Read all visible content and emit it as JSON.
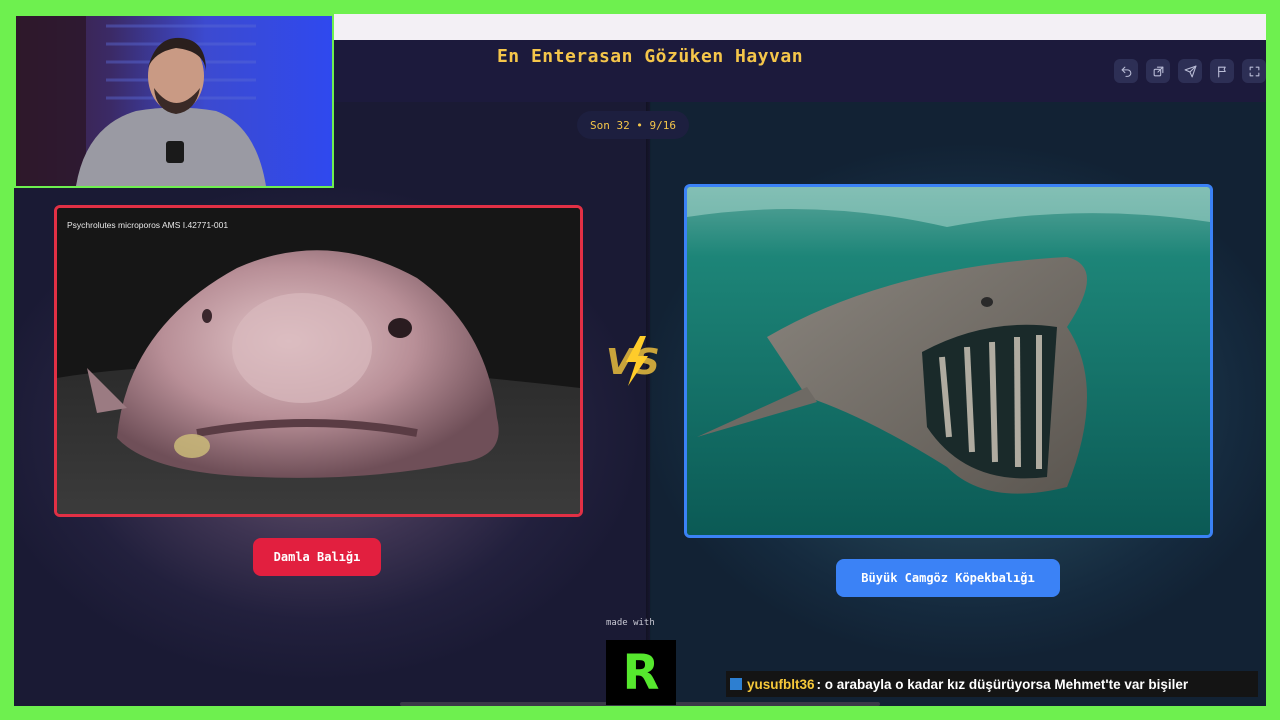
{
  "app": {
    "title": "En Enterasan Gözüken Hayvan",
    "round_pill": "Son 32 • 9/16",
    "made_with": "made with"
  },
  "toolbar": {
    "icons": [
      "undo-icon",
      "share-icon",
      "send-icon",
      "flag-icon",
      "fullscreen-icon"
    ]
  },
  "left": {
    "image_caption": "Psychrolutes microporos AMS I.42771-001",
    "choice_label": "Damla Balığı",
    "accent": "#e21f3f"
  },
  "right": {
    "choice_label": "Büyük Camgöz Köpekbalığı",
    "accent": "#3b82f6"
  },
  "vs_label": "VS",
  "overlay": {
    "logo_letter": "R",
    "chat_user": "yusufblt36",
    "chat_message": ": o arabayla o kadar kız düşürüyorsa Mehmet'te var bişiler"
  },
  "colors": {
    "frame": "#6ef04f",
    "title": "#f5c64a",
    "header_bg": "#1c1a3c"
  }
}
